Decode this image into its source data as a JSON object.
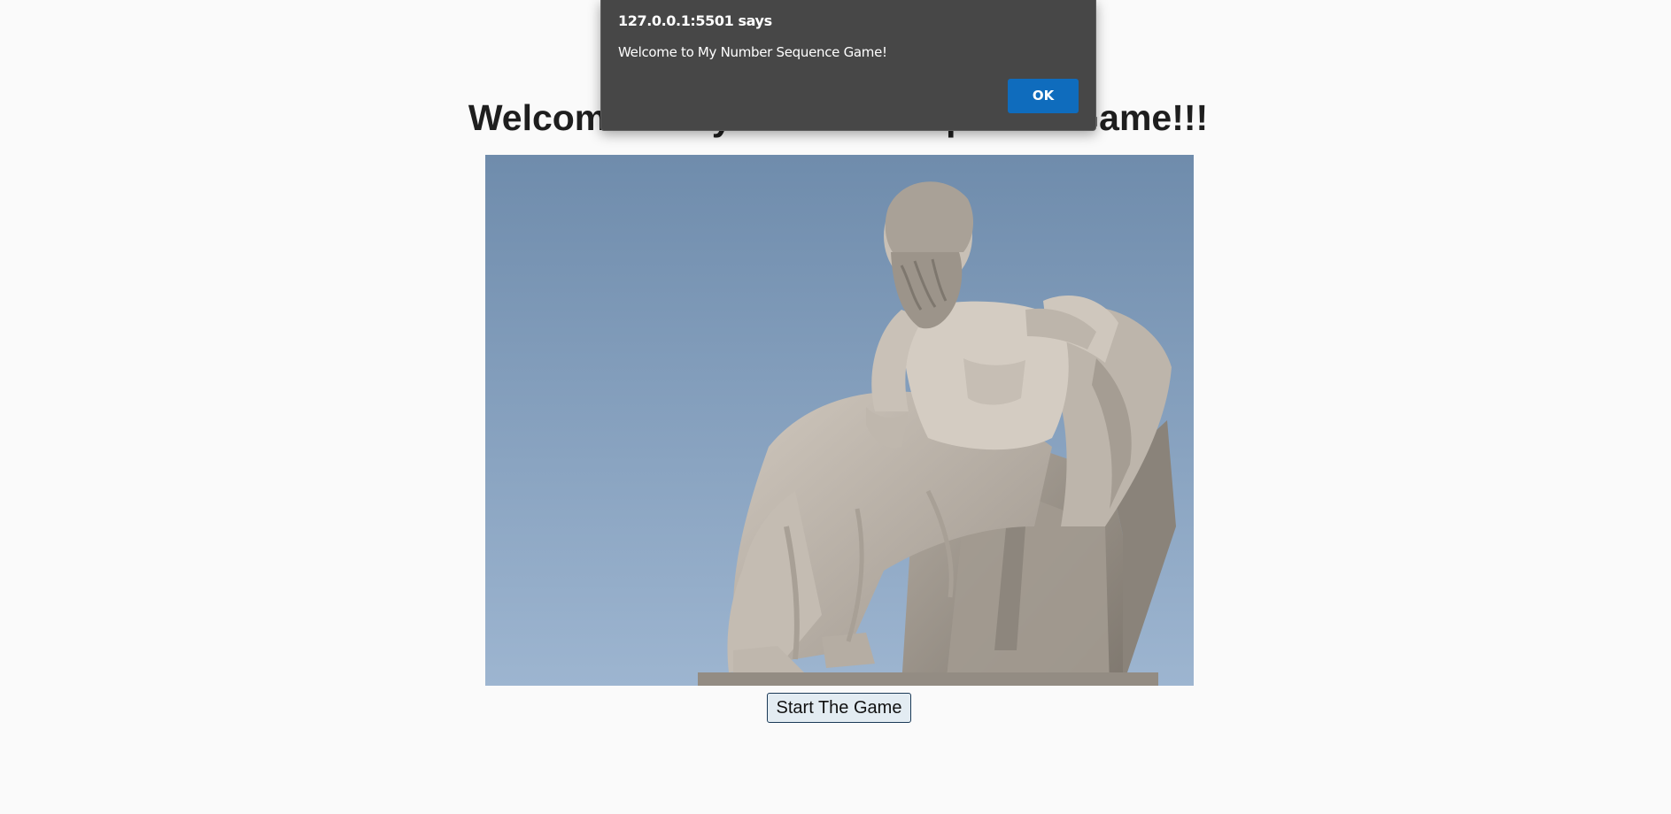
{
  "page": {
    "title": "Welcome to My Number Sequence Game!!!",
    "start_button_label": "Start The Game"
  },
  "image": {
    "description_name": "socrates-statue-image"
  },
  "alert_dialog": {
    "origin": "127.0.0.1:5501 says",
    "message": "Welcome to My Number Sequence Game!",
    "ok_label": "OK"
  },
  "colors": {
    "page_background": "#fafafa",
    "dialog_background": "#474747",
    "ok_button": "#0f6cbd",
    "start_button_background": "#e3ecf2",
    "start_button_border": "#1b3a57",
    "sky_top": "#6f8cac",
    "sky_bottom": "#9db5d0"
  }
}
